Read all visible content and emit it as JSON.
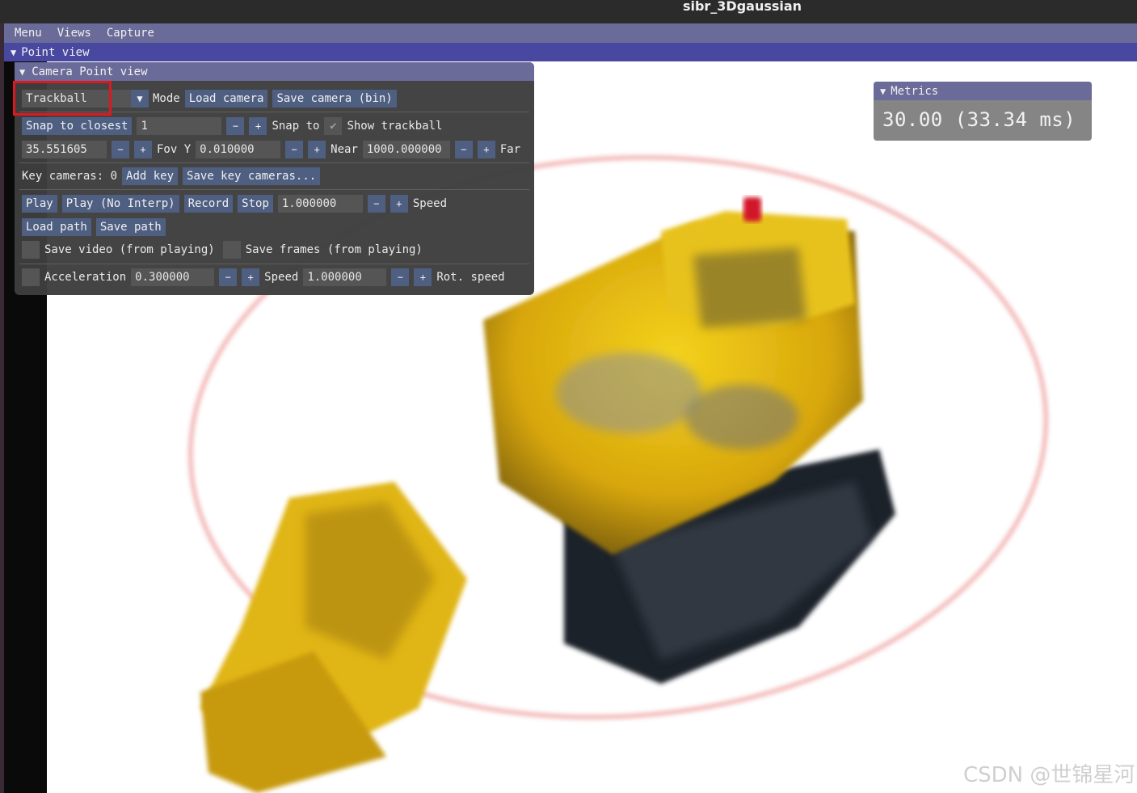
{
  "window": {
    "title": "sibr_3Dgaussian"
  },
  "menubar": {
    "items": [
      "Menu",
      "Views",
      "Capture"
    ]
  },
  "point_view": {
    "label": "Point view"
  },
  "camera_panel": {
    "title": "Camera Point view",
    "mode_select": "Trackball",
    "mode_label": "Mode",
    "load_camera": "Load camera",
    "save_camera": "Save camera (bin)",
    "snap_to_closest": "Snap to closest",
    "snap_value": "1",
    "snap_to_label": "Snap to",
    "show_trackball": "Show trackball",
    "fov_value": "35.551605",
    "fov_label": "Fov Y",
    "near_value": "0.010000",
    "near_label": "Near",
    "far_value": "1000.000000",
    "far_label": "Far",
    "key_cameras_label": "Key cameras: 0",
    "add_key": "Add key",
    "save_key_cameras": "Save key cameras...",
    "play": "Play",
    "play_no_interp": "Play (No Interp)",
    "record": "Record",
    "stop": "Stop",
    "speed_value": "1.000000",
    "speed_label": "Speed",
    "load_path": "Load path",
    "save_path": "Save path",
    "save_video": "Save video (from playing)",
    "save_frames": "Save frames (from playing)",
    "acceleration_label": "Acceleration",
    "acceleration_value": "0.300000",
    "speed2_label": "Speed",
    "speed2_value": "1.000000",
    "rot_speed_label": "Rot. speed",
    "minus": "−",
    "plus": "+"
  },
  "metrics": {
    "title": "Metrics",
    "value": "30.00 (33.34 ms)"
  },
  "watermark": "CSDN @世锦星河",
  "colors": {
    "accent_header": "#6b6b9a",
    "button": "#4e5f82",
    "highlight": "#e0181e"
  }
}
